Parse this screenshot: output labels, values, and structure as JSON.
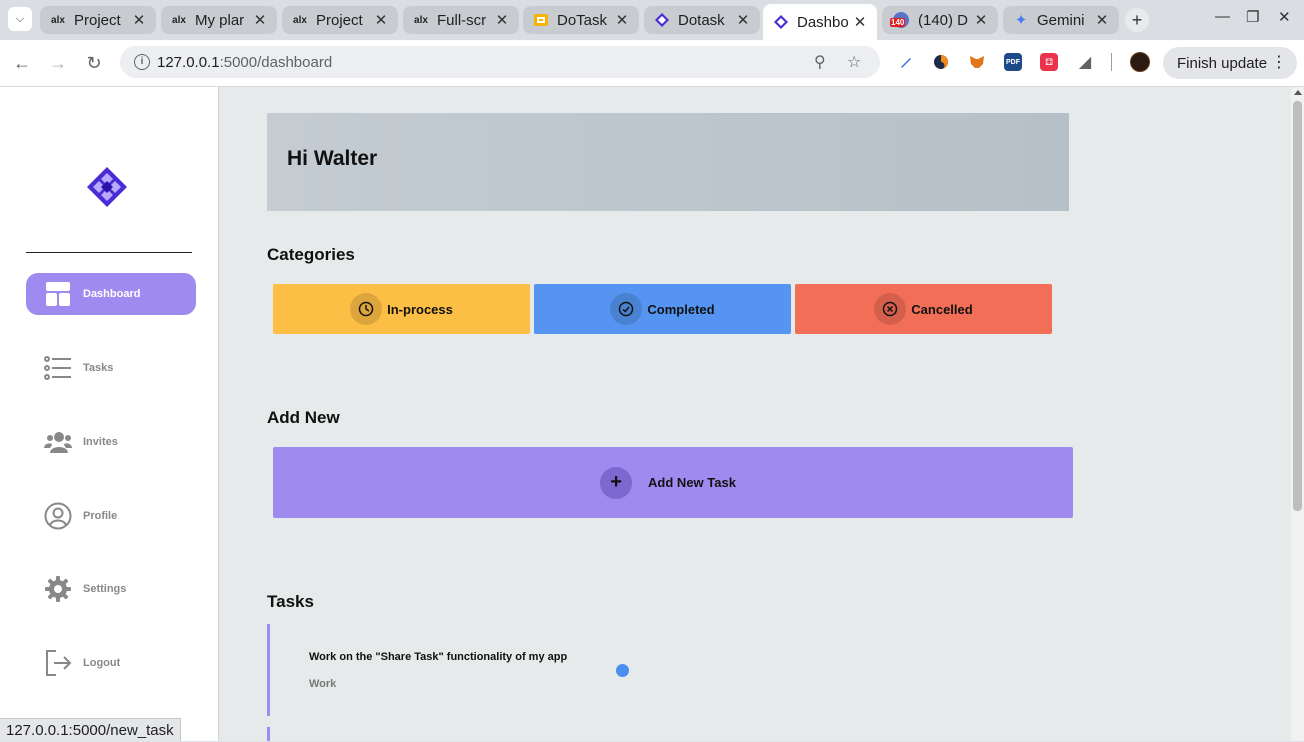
{
  "browser": {
    "tabs": [
      {
        "favicon": "alx-icon",
        "title": "Project",
        "active": false
      },
      {
        "favicon": "alx-icon",
        "title": "My plar",
        "active": false
      },
      {
        "favicon": "alx-icon",
        "title": "Project",
        "active": false
      },
      {
        "favicon": "alx-icon",
        "title": "Full-scr",
        "active": false
      },
      {
        "favicon": "slides-icon",
        "title": "DoTask",
        "active": false
      },
      {
        "favicon": "dotask-icon",
        "title": "Dotask",
        "active": false
      },
      {
        "favicon": "dotask-icon",
        "title": "Dashbo",
        "active": true
      },
      {
        "favicon": "youtube-icon",
        "title": "(140) D",
        "active": false
      },
      {
        "favicon": "gemini-icon",
        "title": "Gemini",
        "active": false
      }
    ],
    "youtube_badge": "140",
    "url_host": "127.0.0.1",
    "url_path": ":5000/dashboard",
    "finish_update_label": "Finish update",
    "status_url": "127.0.0.1:5000/new_task"
  },
  "sidebar": {
    "items": [
      {
        "label": "Dashboard",
        "icon": "dashboard-icon",
        "active": true
      },
      {
        "label": "Tasks",
        "icon": "list-icon",
        "active": false
      },
      {
        "label": "Invites",
        "icon": "users-icon",
        "active": false
      },
      {
        "label": "Profile",
        "icon": "user-circle-icon",
        "active": false
      },
      {
        "label": "Settings",
        "icon": "gear-icon",
        "active": false
      },
      {
        "label": "Logout",
        "icon": "logout-icon",
        "active": false
      }
    ]
  },
  "main": {
    "greeting": "Hi Walter",
    "categories_heading": "Categories",
    "categories": [
      {
        "label": "In-process",
        "icon": "clock-icon",
        "color": "#fcbe45"
      },
      {
        "label": "Completed",
        "icon": "check-circle-icon",
        "color": "#5594f0"
      },
      {
        "label": "Cancelled",
        "icon": "x-circle-icon",
        "color": "#f26e57"
      }
    ],
    "add_new_heading": "Add New",
    "add_new_label": "Add New Task",
    "tasks_heading": "Tasks",
    "tasks": [
      {
        "title": "Work on the \"Share Task\" functionality of my app",
        "category": "Work",
        "status_color": "#4a8ef0"
      }
    ]
  },
  "colors": {
    "accent": "#9f8bf0",
    "in_process": "#fcbe45",
    "completed": "#5594f0",
    "cancelled": "#f26e57"
  }
}
